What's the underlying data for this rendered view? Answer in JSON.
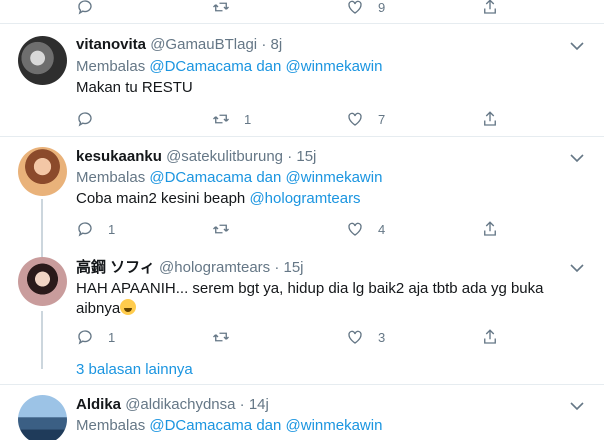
{
  "top_actions": {
    "retweets": "",
    "likes": "9"
  },
  "tweets": [
    {
      "name": "vitanovita",
      "handle": "@GamauBTlagi",
      "time": "8j",
      "reply_prefix": "Membalas",
      "reply_to_1": "@DCamacama",
      "reply_and": "dan",
      "reply_to_2": "@winmekawin",
      "text": "Makan tu RESTU",
      "replies": "",
      "retweets": "1",
      "likes": "7"
    },
    {
      "name": "kesukaanku",
      "handle": "@satekulitburung",
      "time": "15j",
      "reply_prefix": "Membalas",
      "reply_to_1": "@DCamacama",
      "reply_and": "dan",
      "reply_to_2": "@winmekawin",
      "text": "Coba main2 kesini beaph",
      "text_mention": "@hologramtears",
      "replies": "1",
      "retweets": "",
      "likes": "4"
    },
    {
      "name": "高鋼 ソフィ",
      "handle": "@hologramtears",
      "time": "15j",
      "text": "HAH APAANIH... serem bgt ya, hidup dia lg baik2 aja tbtb ada yg buka aibnya",
      "replies": "1",
      "retweets": "",
      "likes": "3"
    },
    {
      "name": "Aldika",
      "handle": "@aldikachydnsa",
      "time": "14j",
      "reply_prefix": "Membalas",
      "reply_to_1": "@DCamacama",
      "reply_and": "dan",
      "reply_to_2": "@winmekawin"
    }
  ],
  "more_replies": "3 balasan lainnya",
  "colors": {
    "link": "#1b95e0",
    "muted": "#657786",
    "border": "#e6ecf0"
  }
}
